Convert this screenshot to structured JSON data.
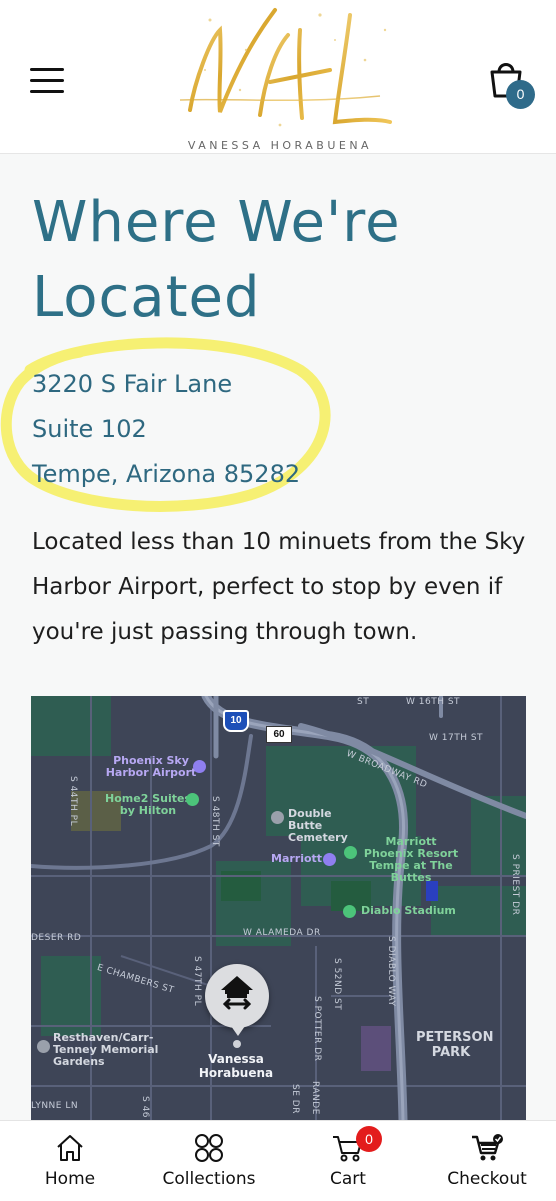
{
  "header": {
    "brand_name": "VANESSA HORABUENA",
    "logo_script": "VH",
    "bag_count": "0"
  },
  "page": {
    "title_line1": "Where We're",
    "title_line2": "Located",
    "address": [
      "3220 S Fair Lane",
      "Suite 102",
      "Tempe, Arizona 85282"
    ],
    "description": "Located less than 10 minuets from the Sky Harbor Airport, perfect to stop by even if you're just passing through town."
  },
  "map": {
    "roads": {
      "w16": "W 16TH ST",
      "w17": "W 17TH ST",
      "broadway": "W BROADWAY RD",
      "s44": "S 44TH PL",
      "s48": "S 48TH ST",
      "alameda": "W ALAMEDA DR",
      "deser": "DESER RD",
      "chambers": "E CHAMBERS ST",
      "s47": "S 47TH PL",
      "s52": "S 52ND ST",
      "potter": "S POTTER DR",
      "diablo": "S DIABLO WAY",
      "priest": "S PRIEST DR",
      "lynne": "LYNNE LN",
      "rande": "RANDE",
      "sedr": "SE DR",
      "st": "ST",
      "s46": "S 46"
    },
    "shields": {
      "i10": "10",
      "r60": "60"
    },
    "pois": {
      "airport": "Phoenix Sky Harbor Airport",
      "home2": "Home2 Suites by Hilton",
      "cemetery": "Double Butte Cemetery",
      "marriott_resort": "Marriott Phoenix Resort Tempe at The Buttes",
      "marriott": "Marriott",
      "diablo": "Diablo Stadium",
      "resthaven": "Resthaven/Carr-Tenney Memorial Gardens",
      "peterson": "PETERSON PARK",
      "store": "Vanessa Horabuena"
    }
  },
  "tabbar": {
    "home": "Home",
    "collections": "Collections",
    "cart": "Cart",
    "checkout": "Checkout",
    "cart_count": "0"
  },
  "colors": {
    "accent": "#2e7087",
    "badge_blue": "#2f6b8a",
    "cart_badge": "#e31c1c",
    "highlight": "#f6ef5c"
  }
}
